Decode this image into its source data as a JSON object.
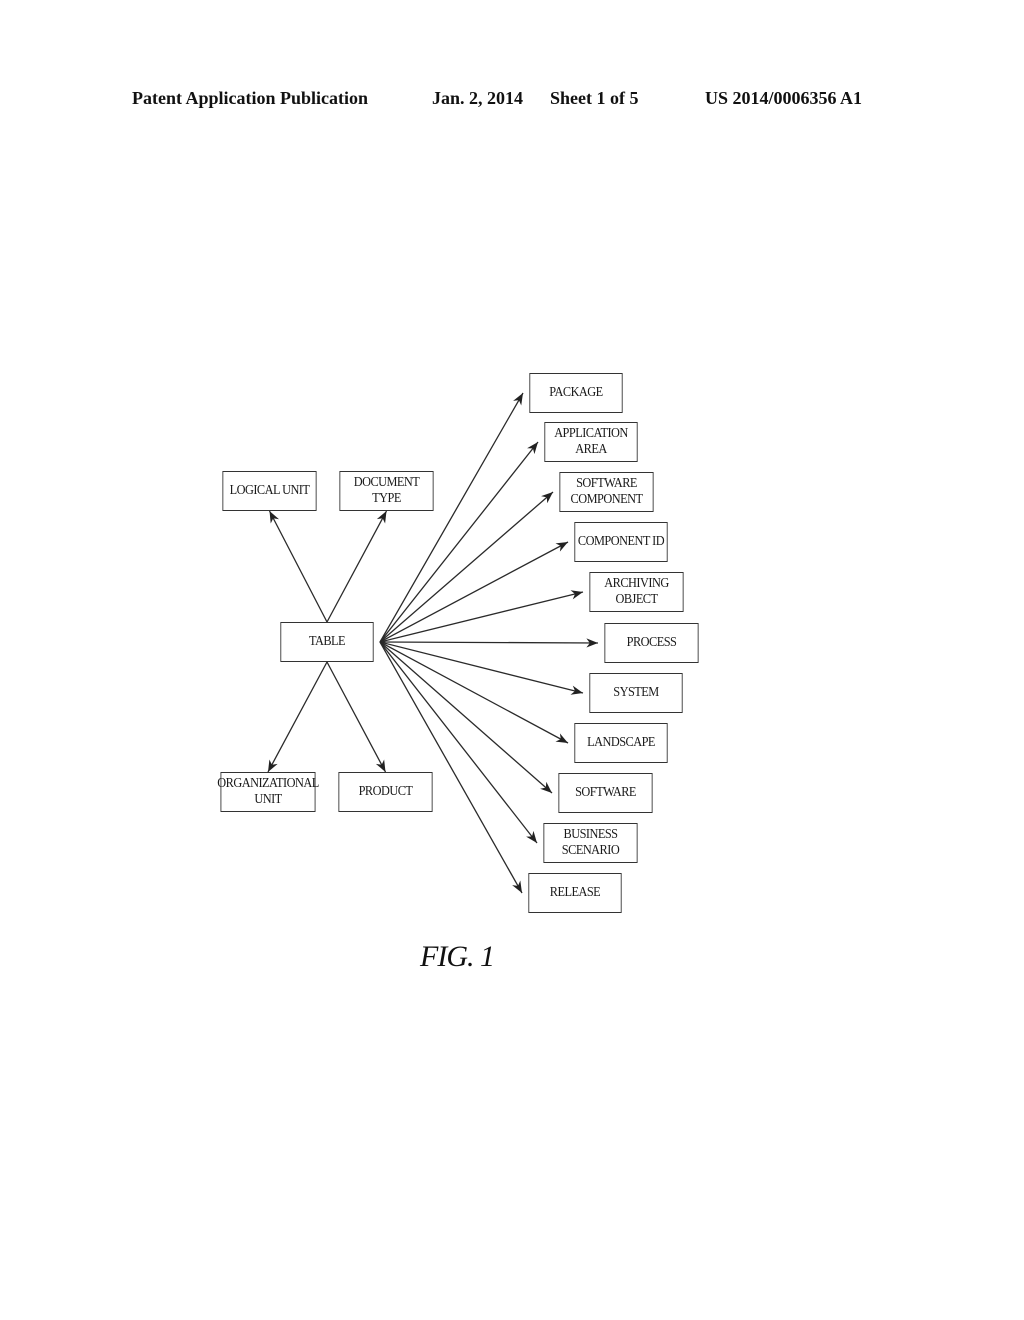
{
  "header": {
    "publication": "Patent Application Publication",
    "date": "Jan. 2, 2014",
    "sheet": "Sheet 1 of 5",
    "number": "US 2014/0006356 A1"
  },
  "diagram": {
    "center": {
      "id": "table",
      "label": "TABLE"
    },
    "nodes": [
      {
        "id": "logical-unit",
        "label": "LOGICAL UNIT"
      },
      {
        "id": "document-type",
        "label": "DOCUMENT\nTYPE"
      },
      {
        "id": "organizational-unit",
        "label": "ORGANIZATIONAL\nUNIT"
      },
      {
        "id": "product",
        "label": "PRODUCT"
      },
      {
        "id": "package",
        "label": "PACKAGE"
      },
      {
        "id": "application-area",
        "label": "APPLICATION\nAREA"
      },
      {
        "id": "software-component",
        "label": "SOFTWARE\nCOMPONENT"
      },
      {
        "id": "component-id",
        "label": "COMPONENT ID"
      },
      {
        "id": "archiving-object",
        "label": "ARCHIVING\nOBJECT"
      },
      {
        "id": "process",
        "label": "PROCESS"
      },
      {
        "id": "system",
        "label": "SYSTEM"
      },
      {
        "id": "landscape",
        "label": "LANDSCAPE"
      },
      {
        "id": "software",
        "label": "SOFTWARE"
      },
      {
        "id": "business-scenario",
        "label": "BUSINESS\nSCENARIO"
      },
      {
        "id": "release",
        "label": "RELEASE"
      }
    ],
    "edges": [
      {
        "from": "table",
        "to": "logical-unit"
      },
      {
        "from": "table",
        "to": "document-type"
      },
      {
        "from": "table",
        "to": "organizational-unit"
      },
      {
        "from": "table",
        "to": "product"
      },
      {
        "from": "table",
        "to": "package"
      },
      {
        "from": "table",
        "to": "application-area"
      },
      {
        "from": "table",
        "to": "software-component"
      },
      {
        "from": "table",
        "to": "component-id"
      },
      {
        "from": "table",
        "to": "archiving-object"
      },
      {
        "from": "table",
        "to": "process"
      },
      {
        "from": "table",
        "to": "system"
      },
      {
        "from": "table",
        "to": "landscape"
      },
      {
        "from": "table",
        "to": "software"
      },
      {
        "from": "table",
        "to": "business-scenario"
      },
      {
        "from": "table",
        "to": "release"
      }
    ]
  },
  "figure_caption": "FIG. 1"
}
